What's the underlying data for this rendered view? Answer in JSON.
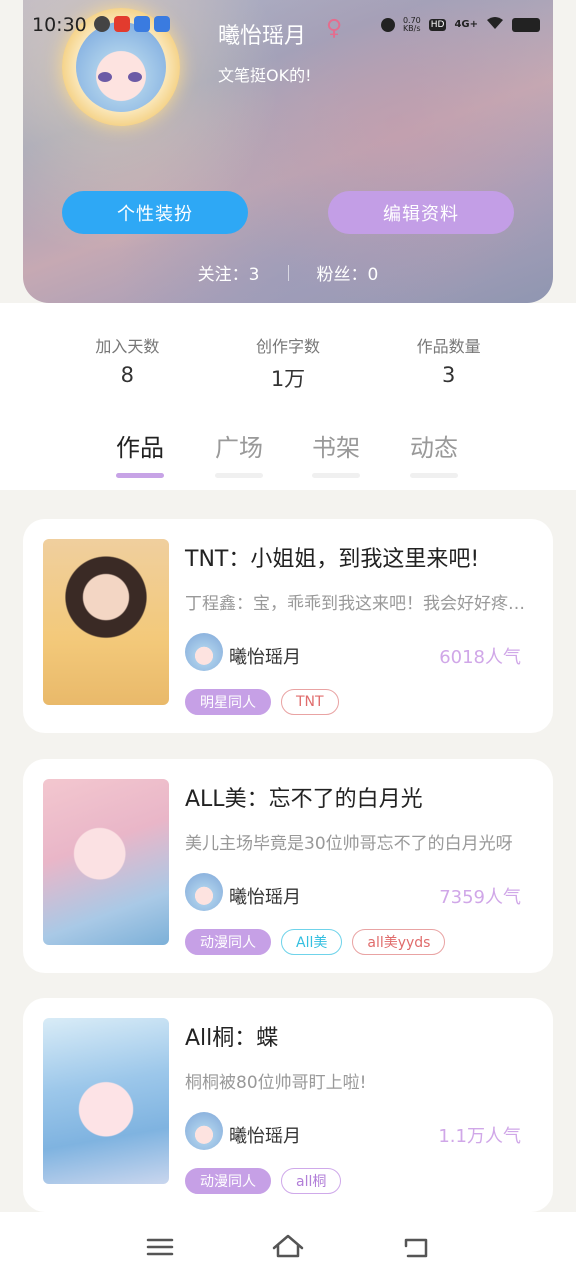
{
  "status_bar": {
    "time": "10:30",
    "net_speed": "0.70\nKB/s",
    "hd": "HD",
    "signal": "4G+"
  },
  "profile": {
    "nickname": "曦怡瑶月",
    "gender_icon": "female-icon",
    "signature": "文笔挺OK的!",
    "buttons": {
      "dress_up": "个性装扮",
      "edit_profile": "编辑资料"
    },
    "follow": "关注：3",
    "fans": "粉丝：0"
  },
  "stats": [
    {
      "label": "加入天数",
      "value": "8"
    },
    {
      "label": "创作字数",
      "value": "1万"
    },
    {
      "label": "作品数量",
      "value": "3"
    }
  ],
  "tabs": [
    {
      "label": "作品",
      "active": true
    },
    {
      "label": "广场",
      "active": false
    },
    {
      "label": "书架",
      "active": false
    },
    {
      "label": "动态",
      "active": false
    }
  ],
  "works": [
    {
      "title": "TNT：小姐姐，到我这里来吧!",
      "desc": "丁程鑫：宝，乖乖到我这来吧！我会好好疼你的",
      "author": "曦怡瑶月",
      "popularity": "6018人气",
      "tags": [
        {
          "text": "明星同人",
          "style": "purple"
        },
        {
          "text": "TNT",
          "style": "red"
        }
      ]
    },
    {
      "title": "ALL美：忘不了的白月光",
      "desc": "美儿主场毕竟是30位帅哥忘不了的白月光呀",
      "author": "曦怡瑶月",
      "popularity": "7359人气",
      "tags": [
        {
          "text": "动漫同人",
          "style": "purple"
        },
        {
          "text": "All美",
          "style": "cyan"
        },
        {
          "text": "all美yyds",
          "style": "red"
        }
      ]
    },
    {
      "title": "All桐：蝶",
      "desc": "桐桐被80位帅哥盯上啦!",
      "author": "曦怡瑶月",
      "popularity": "1.1万人气",
      "tags": [
        {
          "text": "动漫同人",
          "style": "purple"
        },
        {
          "text": "all桐",
          "style": "violet"
        }
      ]
    }
  ],
  "colors": {
    "accent_blue": "#2ea8f5",
    "accent_purple": "#c39ee6",
    "popularity": "#d0a7e8"
  }
}
